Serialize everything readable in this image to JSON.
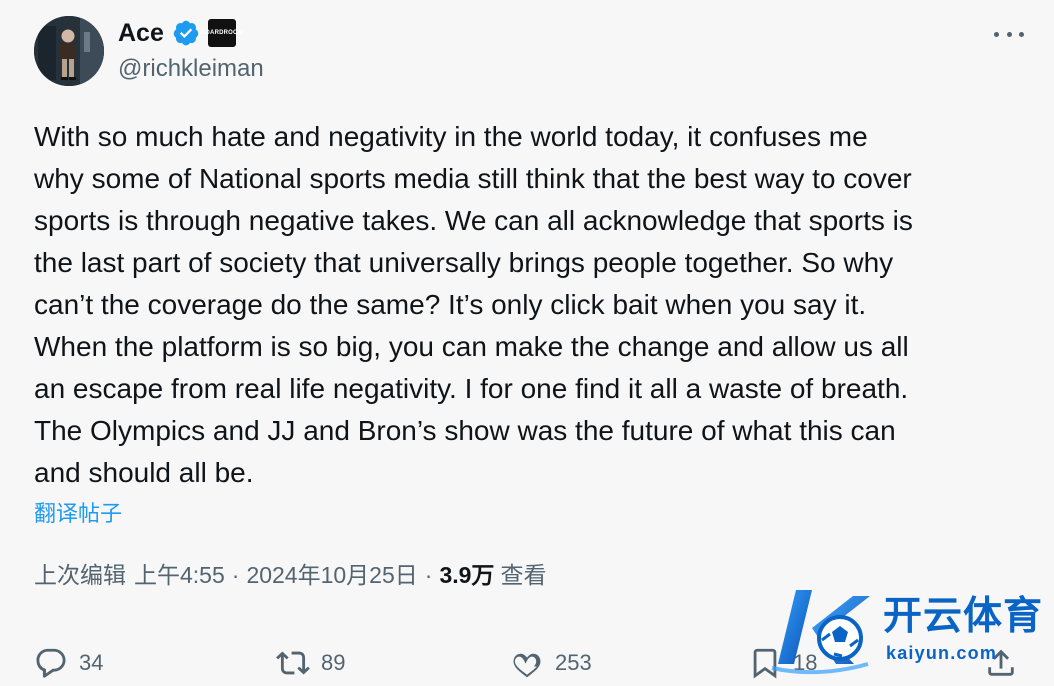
{
  "author": {
    "name": "Ace",
    "handle": "@richkleiman",
    "avatar": "profile-photo",
    "affiliate_badge_text": "BOARDROOM"
  },
  "tweet": {
    "text": "With so much hate and negativity in the world today,  it confuses me\nwhy some of National sports media still think that the best way to cover\nsports is through negative takes. We can all acknowledge that sports is\nthe last part of society that universally brings people together. So why\ncan’t the coverage do the same? It’s only click bait when you say it.\nWhen the platform is so big,  you can make the change and allow us all\nan escape from real life negativity.  I for one find it all a waste of breath.\nThe Olympics and JJ and Bron’s show was the future of what this can\nand should all be.",
    "translate_label": "翻译帖子"
  },
  "meta": {
    "edited_label": "上次编辑",
    "time": "上午4:55",
    "date": "2024年10月25日",
    "separator": "·",
    "views_count": "3.9万",
    "views_label": "查看"
  },
  "actions": {
    "reply_count": "34",
    "repost_count": "89",
    "like_count": "253",
    "bookmark_count": "18"
  },
  "watermark": {
    "title": "开云体育",
    "url": "kaiyun.com"
  },
  "colors": {
    "background": "#f7f7f7",
    "text_primary": "#0f1419",
    "text_secondary": "#536471",
    "link": "#1d9bf0",
    "verified": "#1d9bf0",
    "watermark_blue": "#0a64c6"
  },
  "icons": {
    "verified": "verified-badge-icon",
    "more": "more-icon",
    "reply": "reply-icon",
    "repost": "repost-icon",
    "like": "like-icon",
    "bookmark": "bookmark-icon",
    "share": "share-icon"
  }
}
